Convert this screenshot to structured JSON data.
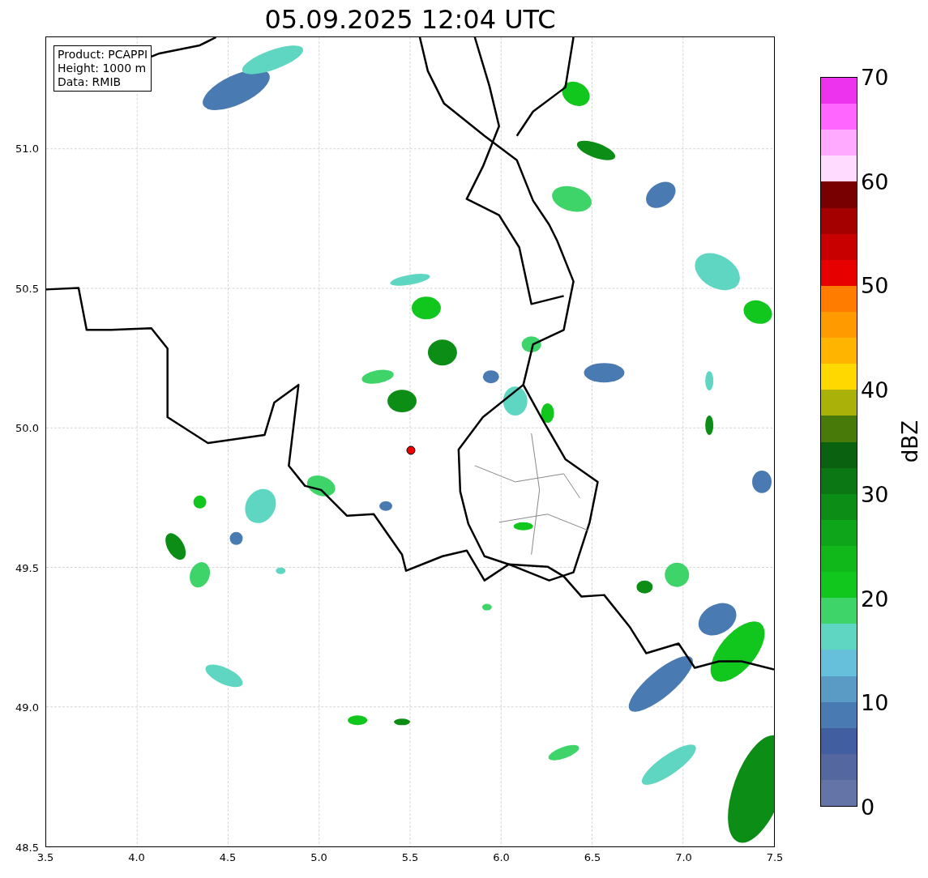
{
  "title": "05.09.2025 12:04 UTC",
  "info_box": [
    "Product: PCAPPI",
    "Height: 1000 m",
    "Data: RMIB"
  ],
  "x_axis": {
    "ticks": [
      "3.5",
      "4.0",
      "4.5",
      "5.0",
      "5.5",
      "6.0",
      "6.5",
      "7.0",
      "7.5"
    ]
  },
  "y_axis": {
    "ticks": [
      "51.0",
      "50.5",
      "50.0",
      "49.5",
      "49.0",
      "48.5"
    ]
  },
  "colorbar": {
    "label": "dBZ",
    "ticks": [
      "70",
      "60",
      "50",
      "40",
      "30",
      "20",
      "10",
      "0"
    ],
    "segments": [
      {
        "color": "#6474a6"
      },
      {
        "color": "#54679f"
      },
      {
        "color": "#405ea0"
      },
      {
        "color": "#4a7ab2"
      },
      {
        "color": "#5a9bc6"
      },
      {
        "color": "#66c0dc"
      },
      {
        "color": "#5fd6c2"
      },
      {
        "color": "#3ed46a"
      },
      {
        "color": "#11c61c"
      },
      {
        "color": "#10b81a"
      },
      {
        "color": "#0fa51a"
      },
      {
        "color": "#0c8d16"
      },
      {
        "color": "#0a7614"
      },
      {
        "color": "#0a6210"
      },
      {
        "color": "#477a08"
      },
      {
        "color": "#aab20a"
      },
      {
        "color": "#ffd800"
      },
      {
        "color": "#ffb400"
      },
      {
        "color": "#ff9a00"
      },
      {
        "color": "#ff7c00"
      },
      {
        "color": "#e60000"
      },
      {
        "color": "#c80000"
      },
      {
        "color": "#a40000"
      },
      {
        "color": "#780000"
      },
      {
        "color": "#ffdcff"
      },
      {
        "color": "#ffaaff"
      },
      {
        "color": "#ff66ff"
      },
      {
        "color": "#ee33ee"
      }
    ]
  }
}
